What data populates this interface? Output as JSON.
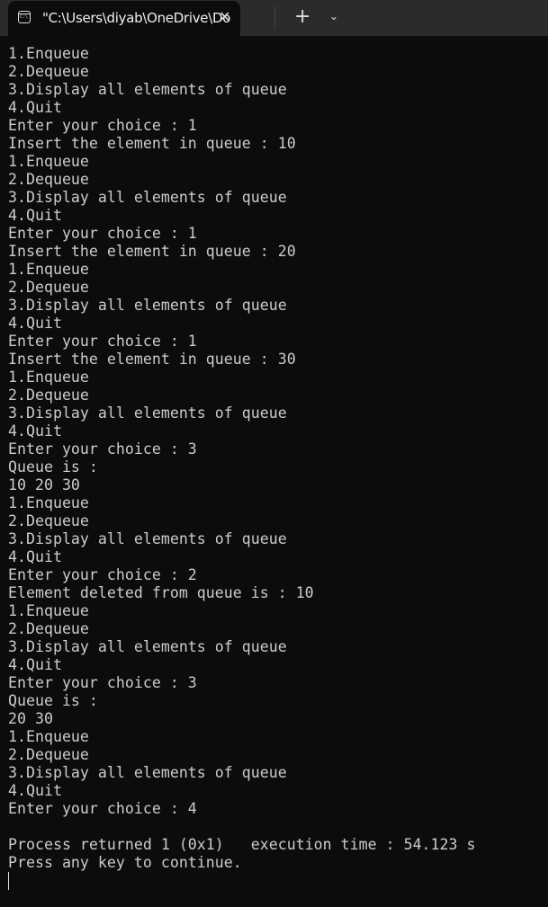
{
  "window": {
    "tab_title": "\"C:\\Users\\diyab\\OneDrive\\Do",
    "tab_icon": "console-icon",
    "tab_icon_text": "C:\\",
    "close_glyph": "✕",
    "new_tab_glyph": "+",
    "dropdown_glyph": "⌄"
  },
  "console": {
    "lines": [
      "1.Enqueue",
      "2.Dequeue",
      "3.Display all elements of queue",
      "4.Quit",
      "Enter your choice : 1",
      "Insert the element in queue : 10",
      "1.Enqueue",
      "2.Dequeue",
      "3.Display all elements of queue",
      "4.Quit",
      "Enter your choice : 1",
      "Insert the element in queue : 20",
      "1.Enqueue",
      "2.Dequeue",
      "3.Display all elements of queue",
      "4.Quit",
      "Enter your choice : 1",
      "Insert the element in queue : 30",
      "1.Enqueue",
      "2.Dequeue",
      "3.Display all elements of queue",
      "4.Quit",
      "Enter your choice : 3",
      "Queue is :",
      "10 20 30",
      "1.Enqueue",
      "2.Dequeue",
      "3.Display all elements of queue",
      "4.Quit",
      "Enter your choice : 2",
      "Element deleted from queue is : 10",
      "1.Enqueue",
      "2.Dequeue",
      "3.Display all elements of queue",
      "4.Quit",
      "Enter your choice : 3",
      "Queue is :",
      "20 30",
      "1.Enqueue",
      "2.Dequeue",
      "3.Display all elements of queue",
      "4.Quit",
      "Enter your choice : 4",
      "",
      "Process returned 1 (0x1)   execution time : 54.123 s",
      "Press any key to continue."
    ]
  }
}
